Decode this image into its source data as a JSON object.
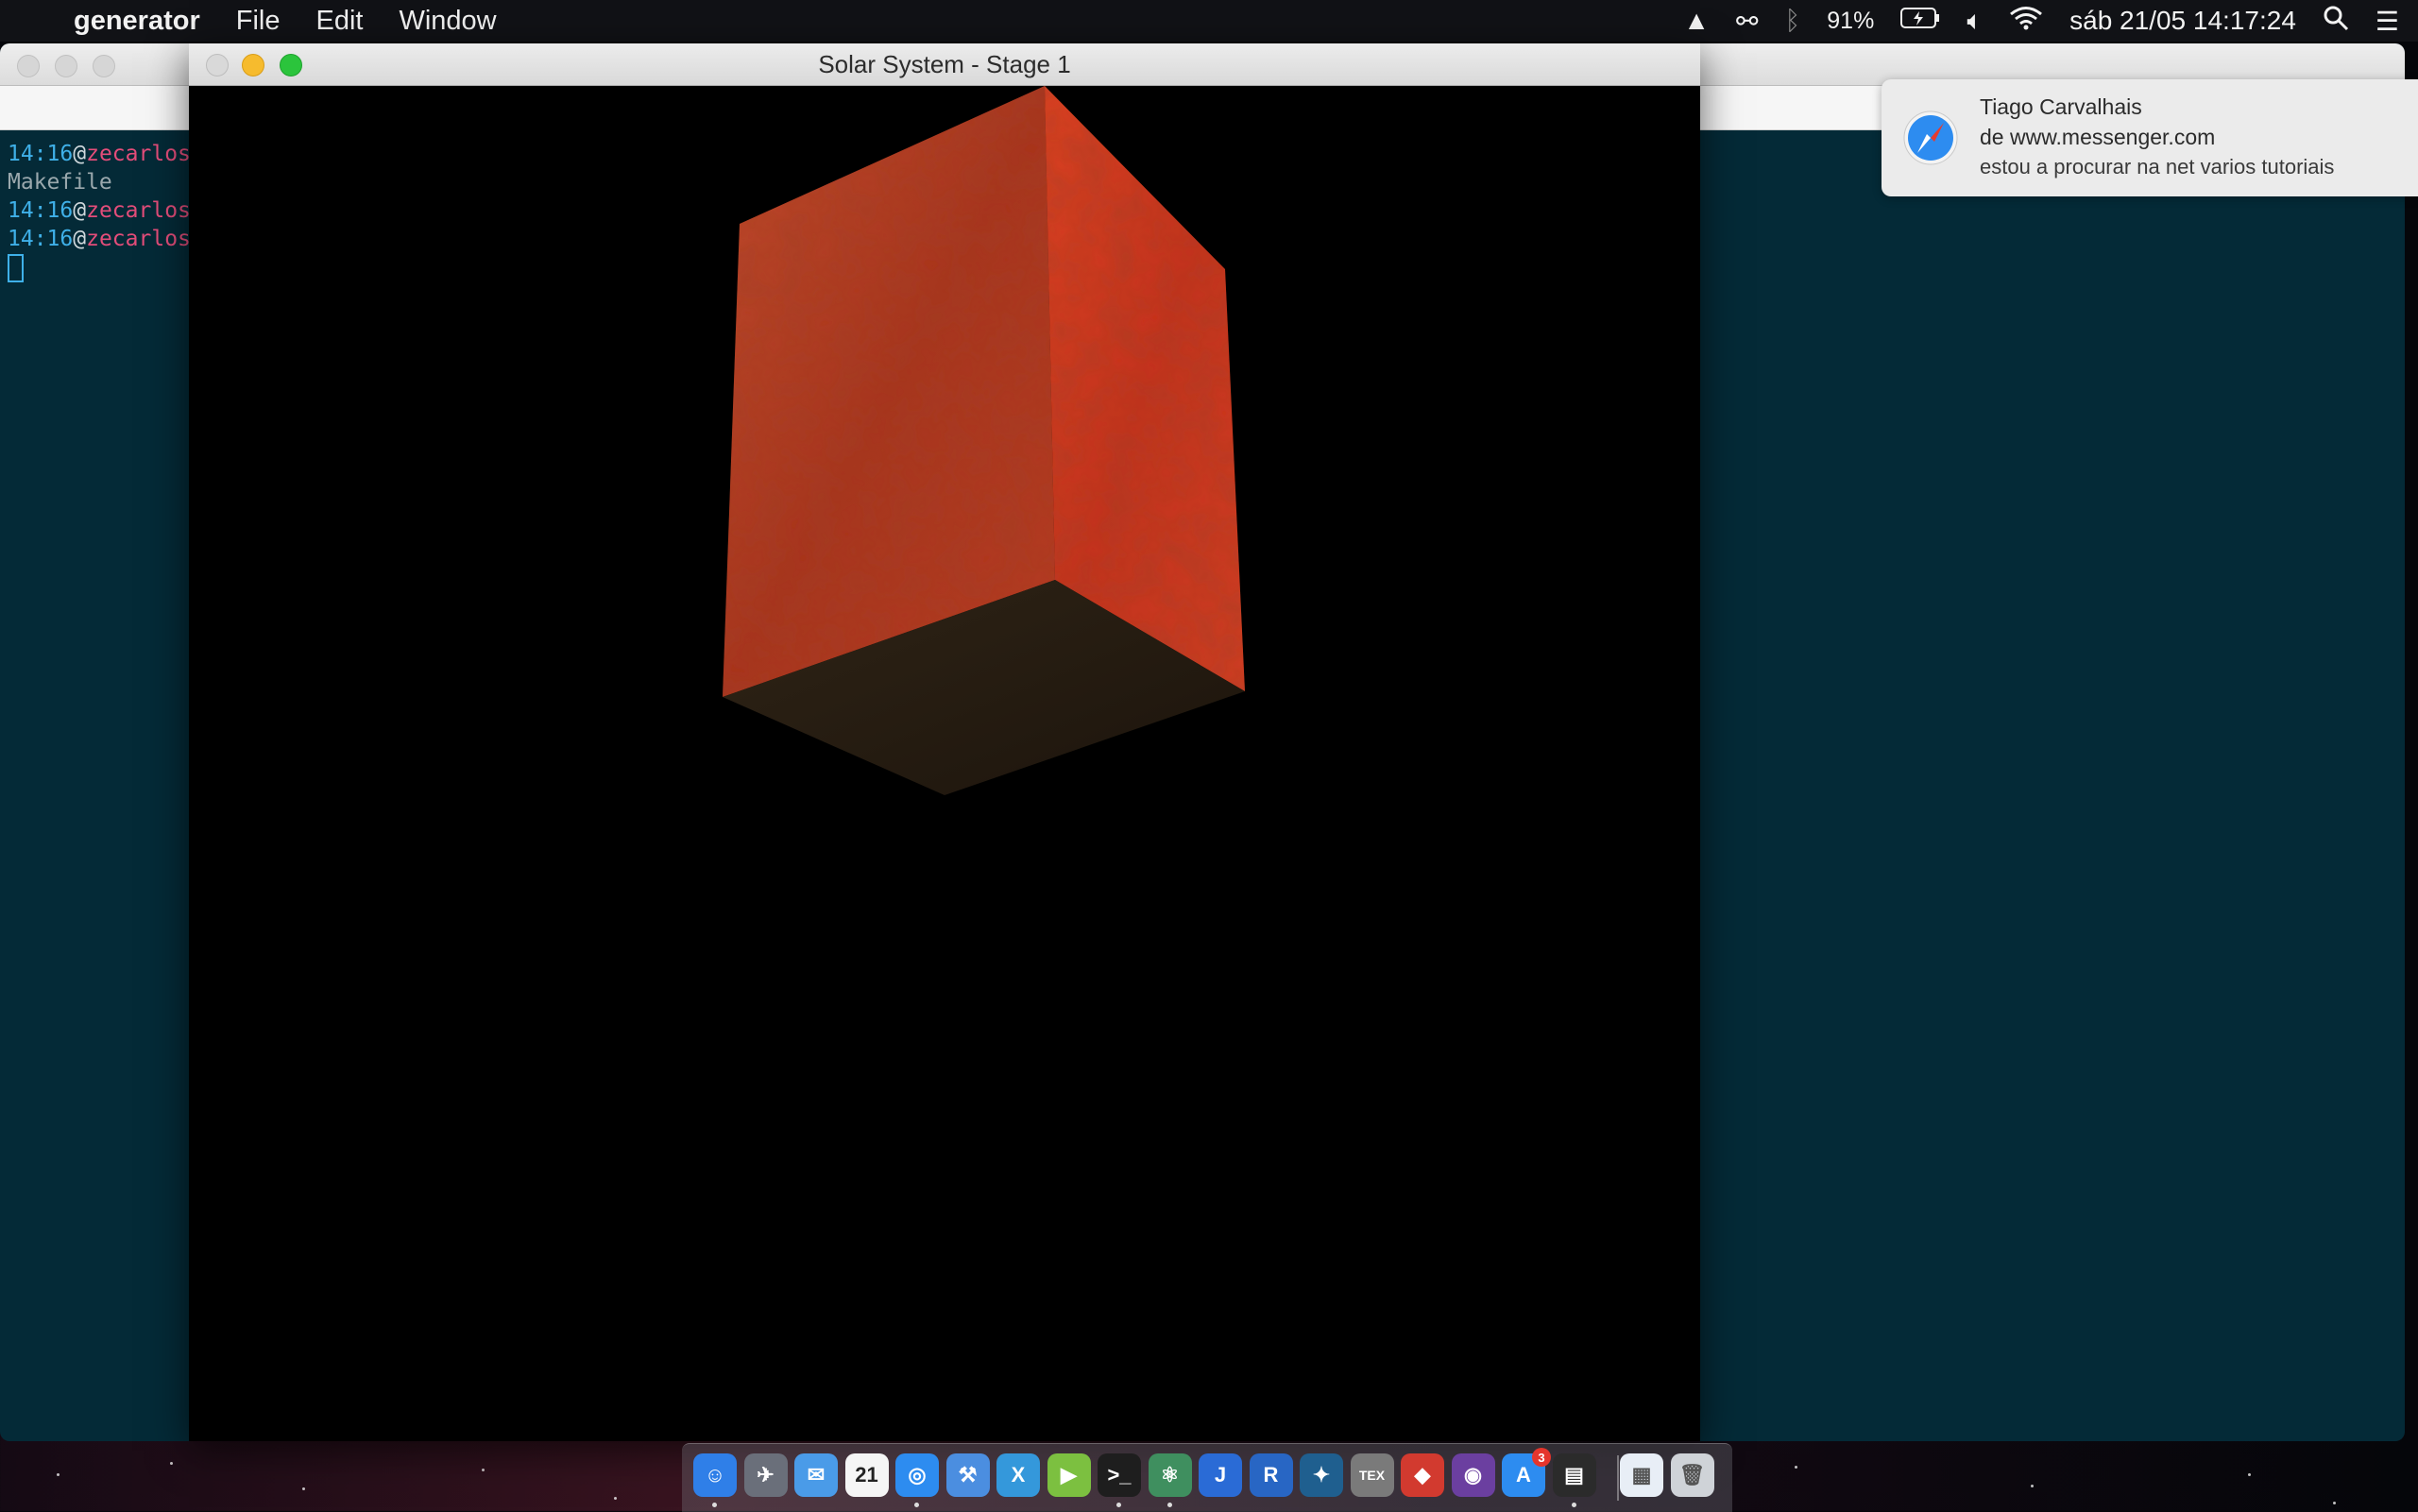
{
  "menubar": {
    "app_name": "generator",
    "menus": [
      "File",
      "Edit",
      "Window"
    ],
    "battery": "91%",
    "clock": "sáb 21/05  14:17:24"
  },
  "terminal": {
    "lines": [
      {
        "time": "14:16",
        "user": "zecarlos"
      },
      {
        "plain": "Makefile"
      },
      {
        "time": "14:16",
        "user": "zecarlos"
      },
      {
        "time": "14:16",
        "user": "zecarlos"
      }
    ]
  },
  "solar_window": {
    "title": "Solar System - Stage 1"
  },
  "notification": {
    "title": "Tiago Carvalhais",
    "subtitle": "de www.messenger.com",
    "body": "estou a procurar na net varios tutoriais"
  },
  "dock": {
    "items": [
      {
        "name": "finder-icon",
        "color": "#2f7fe8",
        "glyph": "☺"
      },
      {
        "name": "launchpad-icon",
        "color": "#6a6f7a",
        "glyph": "✈"
      },
      {
        "name": "mail-icon",
        "color": "#4a9be8",
        "glyph": "✉"
      },
      {
        "name": "calendar-icon",
        "color": "#f5f5f5",
        "glyph": "21"
      },
      {
        "name": "safari-icon",
        "color": "#2d8cf0",
        "glyph": "◎"
      },
      {
        "name": "xcode-icon",
        "color": "#4b8ee0",
        "glyph": "⚒"
      },
      {
        "name": "xamarin-icon",
        "color": "#3498db",
        "glyph": "X"
      },
      {
        "name": "play-icon",
        "color": "#7cc040",
        "glyph": "▶"
      },
      {
        "name": "terminal-icon",
        "color": "#1e1e1e",
        "glyph": ">_"
      },
      {
        "name": "atom-icon",
        "color": "#3f8f5f",
        "glyph": "⚛"
      },
      {
        "name": "intellij-icon",
        "color": "#2a6bd6",
        "glyph": "J"
      },
      {
        "name": "r-icon",
        "color": "#2866c4",
        "glyph": "R"
      },
      {
        "name": "mysql-icon",
        "color": "#1f5f8f",
        "glyph": "✦"
      },
      {
        "name": "tex-icon",
        "color": "#7a7a7a",
        "glyph": "TEX"
      },
      {
        "name": "git-icon",
        "color": "#d23a2f",
        "glyph": "◆"
      },
      {
        "name": "github-icon",
        "color": "#6b3fa0",
        "glyph": "◉"
      },
      {
        "name": "appstore-icon",
        "color": "#2d8cf0",
        "glyph": "A",
        "badge": "3"
      },
      {
        "name": "console-icon",
        "color": "#2b2b2b",
        "glyph": "▤"
      },
      {
        "name": "saver-icon",
        "color": "#e8eef6",
        "glyph": "▦"
      },
      {
        "name": "trash-icon",
        "color": "#cfd3d8",
        "glyph": "🗑"
      }
    ]
  },
  "colors": {
    "cube_front": "#b8361d",
    "cube_right": "#d23a1e",
    "cube_bottom": "#2a1d12"
  }
}
